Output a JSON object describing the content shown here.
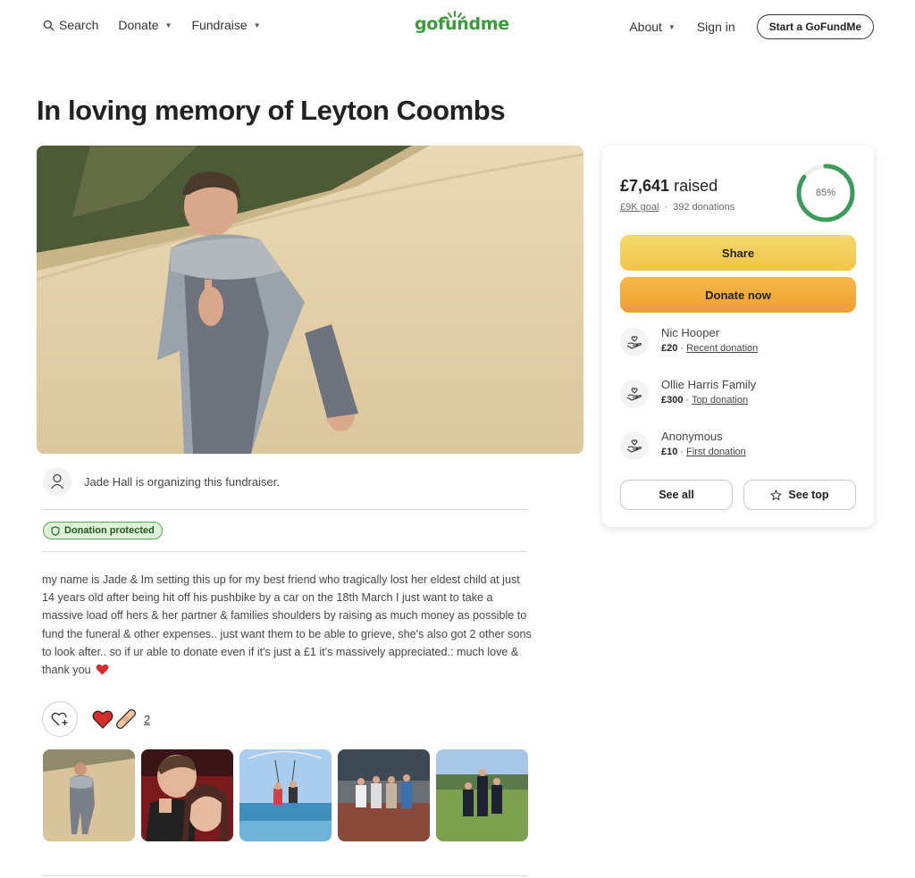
{
  "header": {
    "search_label": "Search",
    "donate_label": "Donate",
    "fundraise_label": "Fundraise",
    "logo_text": "gofundme",
    "about_label": "About",
    "signin_label": "Sign in",
    "start_label": "Start a GoFundMe"
  },
  "page": {
    "title": "In loving memory of Leyton Coombs"
  },
  "organizer": {
    "text": "Jade Hall is organizing this fundraiser."
  },
  "badge": {
    "label": "Donation protected"
  },
  "story": {
    "text": "my name is Jade & Im setting this up for my best friend who tragically lost her eldest child at just 14 years old after being hit off his pushbike by a car on the 18th March I just want to take a massive load off hers & her partner & families shoulders by raising as much money as possible to fund the funeral & other expenses.. just want them to be able to grieve, she's also got 2 other sons to look after.. so if ur able to donate even if it's just a £1 it's massively appreciated.: much love & thank you"
  },
  "reactions": {
    "count": "2"
  },
  "card": {
    "raised_amount": "£7,641",
    "raised_label": "raised",
    "goal": "£9K goal",
    "separator": "·",
    "donations": "392 donations",
    "progress_label": "85%",
    "progress_fraction": 0.85,
    "share_label": "Share",
    "donate_label": "Donate now",
    "donors": [
      {
        "name": "Nic Hooper",
        "amount": "£20",
        "tag": "Recent donation"
      },
      {
        "name": "Ollie Harris Family",
        "amount": "£300",
        "tag": "Top donation"
      },
      {
        "name": "Anonymous",
        "amount": "£10",
        "tag": "First donation"
      }
    ],
    "see_all_label": "See all",
    "see_top_label": "See top"
  },
  "colors": {
    "brand_green": "#3a9b3a",
    "share_yellow": "#f0c54b",
    "donate_orange": "#ee9f2a",
    "badge_bg": "#dff2d8"
  }
}
